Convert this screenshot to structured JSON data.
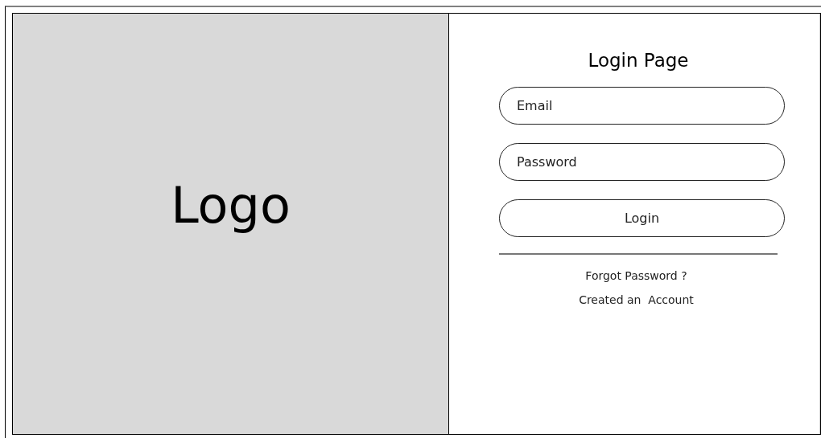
{
  "logo_panel": {
    "text": "Logo"
  },
  "login_form": {
    "title": "Login Page",
    "fields": [
      {
        "placeholder": "Email"
      },
      {
        "placeholder": "Password"
      }
    ],
    "submit_button": "Login",
    "links": [
      "Forgot Password ?",
      "Created an  Account"
    ]
  }
}
